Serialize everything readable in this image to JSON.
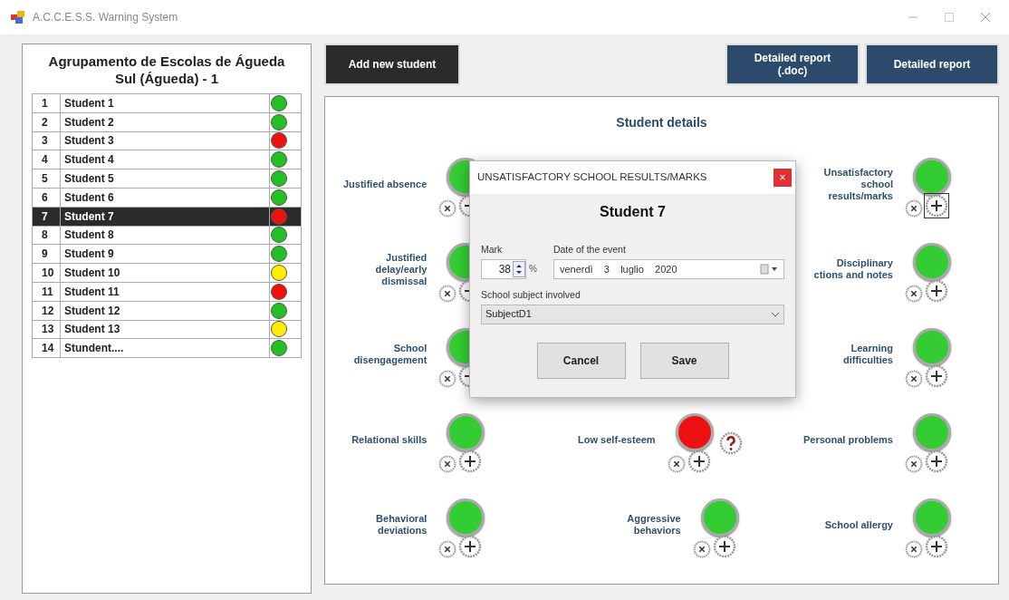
{
  "window": {
    "title": "A.C.C.E.S.S. Warning System"
  },
  "school": {
    "title": "Agrupamento de Escolas de Águeda Sul (Águeda) - 1"
  },
  "students": [
    {
      "number": "1",
      "name": "Student 1",
      "color": "#22c022",
      "selected": false
    },
    {
      "number": "2",
      "name": "Student 2",
      "color": "#22c022",
      "selected": false
    },
    {
      "number": "3",
      "name": "Student 3",
      "color": "#ee1111",
      "selected": false
    },
    {
      "number": "4",
      "name": "Student 4",
      "color": "#22c022",
      "selected": false
    },
    {
      "number": "5",
      "name": "Student 5",
      "color": "#22c022",
      "selected": false
    },
    {
      "number": "6",
      "name": "Student 6",
      "color": "#22c022",
      "selected": false
    },
    {
      "number": "7",
      "name": "Student 7",
      "color": "#ee1111",
      "selected": true
    },
    {
      "number": "8",
      "name": "Student 8",
      "color": "#22c022",
      "selected": false
    },
    {
      "number": "9",
      "name": "Student 9",
      "color": "#22c022",
      "selected": false
    },
    {
      "number": "10",
      "name": "Student 10",
      "color": "#ffee00",
      "selected": false
    },
    {
      "number": "11",
      "name": "Student 11",
      "color": "#ee1111",
      "selected": false
    },
    {
      "number": "12",
      "name": "Student 12",
      "color": "#22c022",
      "selected": false
    },
    {
      "number": "13",
      "name": "Student 13",
      "color": "#ffee00",
      "selected": false
    },
    {
      "number": "14",
      "name": "Stundent....",
      "color": "#22c022",
      "selected": false
    }
  ],
  "toolbar": {
    "add_button": "Add new student",
    "report_buttons": [
      "Detailed report\n(.doc)",
      "Detailed report"
    ]
  },
  "details": {
    "title": "Student details",
    "columns": [
      {
        "indicators": [
          {
            "label": "Justified absence",
            "color": "#33cc33",
            "help": false,
            "focused": false
          },
          {
            "label": "Justified\ndelay/early\ndismissal",
            "color": "#33cc33",
            "help": false,
            "focused": false
          },
          {
            "label": "School\ndisengagement",
            "color": "#33cc33",
            "help": false,
            "focused": false
          },
          {
            "label": "Relational skills",
            "color": "#33cc33",
            "help": false,
            "focused": false
          },
          {
            "label": "Behavioral\ndeviations",
            "color": "#33cc33",
            "help": false,
            "focused": false
          }
        ]
      },
      {
        "indicators": [
          {
            "label": "Low self-esteem",
            "color": "#ee1111",
            "help": true,
            "focused": false
          },
          {
            "label": "Aggressive\nbehaviors",
            "color": "#33cc33",
            "help": false,
            "focused": false
          }
        ]
      },
      {
        "indicators": [
          {
            "label": "Unsatisfactory\nschool\nresults/marks",
            "color": "#33cc33",
            "help": false,
            "focused": true
          },
          {
            "label": "Disciplinary\nctions and notes",
            "color": "#33cc33",
            "help": false,
            "focused": false
          },
          {
            "label": "Learning\ndifficulties",
            "color": "#33cc33",
            "help": false,
            "focused": false
          },
          {
            "label": "Personal problems",
            "color": "#33cc33",
            "help": false,
            "focused": false
          },
          {
            "label": "School allergy",
            "color": "#33cc33",
            "help": false,
            "focused": false
          }
        ]
      }
    ]
  },
  "dialog": {
    "title": "UNSATISFACTORY SCHOOL RESULTS/MARKS",
    "close": "×",
    "student": "Student 7",
    "mark_label": "Mark",
    "mark_value": "38",
    "mark_unit": "%",
    "date_label": "Date of the event",
    "date_value": "venerdì    3    luglio    2020",
    "subject_label": "School subject involved",
    "subject_value": "SubjectD1",
    "buttons": [
      "Cancel",
      "Save"
    ]
  }
}
